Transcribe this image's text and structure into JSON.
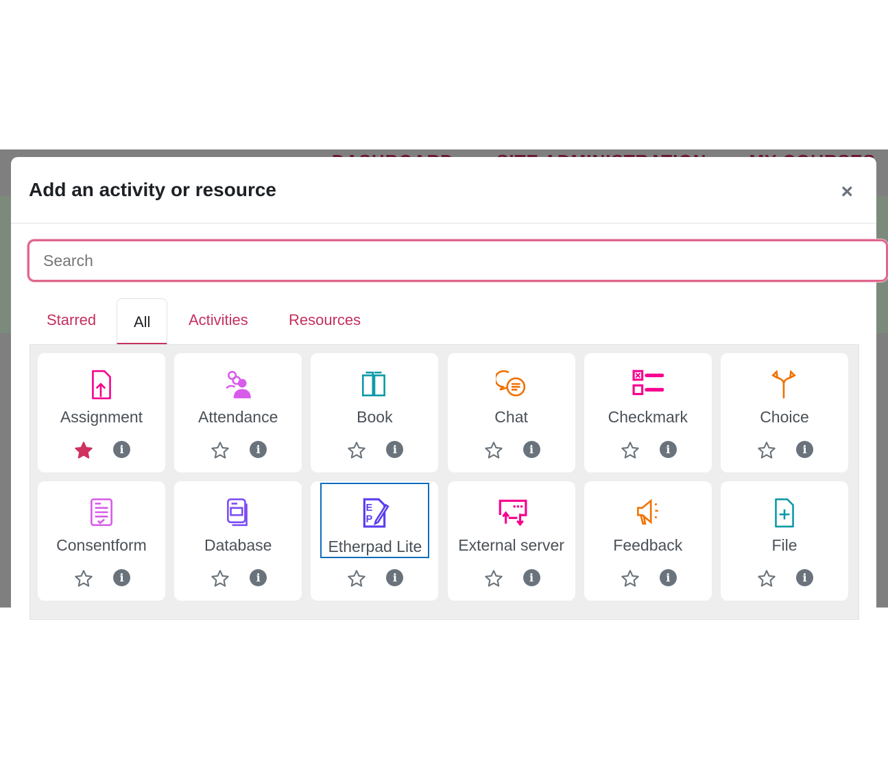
{
  "background_nav": [
    "DASHBOARD",
    "SITE ADMINISTRATION",
    "MY COURSES"
  ],
  "modal": {
    "title": "Add an activity or resource",
    "close_label": "×"
  },
  "search": {
    "placeholder": "Search",
    "value": ""
  },
  "tabs": [
    {
      "label": "Starred",
      "active": false
    },
    {
      "label": "All",
      "active": true
    },
    {
      "label": "Activities",
      "active": false
    },
    {
      "label": "Resources",
      "active": false
    }
  ],
  "items": [
    {
      "name": "Assignment",
      "icon": "assignment-upload-icon",
      "color": "#f7008e",
      "starred": true
    },
    {
      "name": "Attendance",
      "icon": "attendance-people-icon",
      "color": "#d85bea",
      "starred": false
    },
    {
      "name": "Book",
      "icon": "book-icon",
      "color": "#0c9aa6",
      "starred": false
    },
    {
      "name": "Chat",
      "icon": "chat-bubbles-icon",
      "color": "#f07000",
      "starred": false
    },
    {
      "name": "Checkmark",
      "icon": "checklist-icon",
      "color": "#f7008e",
      "starred": false
    },
    {
      "name": "Choice",
      "icon": "split-arrows-icon",
      "color": "#f07000",
      "starred": false
    },
    {
      "name": "Consentform",
      "icon": "consent-form-icon",
      "color": "#d85bea",
      "starred": false
    },
    {
      "name": "Database",
      "icon": "database-icon",
      "color": "#7a4df4",
      "starred": false
    },
    {
      "name": "Etherpad Lite",
      "icon": "etherpad-icon",
      "color": "#5b3cf0",
      "starred": false,
      "focused": true
    },
    {
      "name": "External server",
      "icon": "external-server-icon",
      "color": "#f7008e",
      "starred": false
    },
    {
      "name": "Feedback",
      "icon": "megaphone-icon",
      "color": "#f07000",
      "starred": false
    },
    {
      "name": "File",
      "icon": "file-add-icon",
      "color": "#0c9aa6",
      "starred": false
    }
  ],
  "colors": {
    "accent": "#c5305e",
    "star_filled": "#d0315f",
    "info": "#6a737b",
    "focus": "#0f6cbf"
  },
  "info_glyph": "i"
}
